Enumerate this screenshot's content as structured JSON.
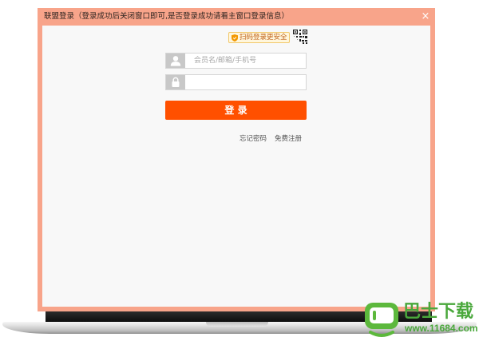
{
  "window": {
    "title": "联盟登录（登录成功后关闭窗口即可,是否登录成功请看主窗口登录信息）",
    "close_label": "×"
  },
  "qr_login": {
    "badge_label": "扫码登录更安全",
    "badge_icon": "shield-icon",
    "toggle_icon": "qr-code-icon"
  },
  "form": {
    "username": {
      "placeholder": "会员名/邮箱/手机号",
      "icon": "user-icon"
    },
    "password": {
      "icon": "lock-icon"
    },
    "login_label": "登 录"
  },
  "links": {
    "forgot_password": "忘记密码",
    "register": "免费注册"
  },
  "watermark": {
    "logo_icon": "monitor-logo-icon",
    "name": "巴士下载",
    "url": "www.11684.com"
  },
  "colors": {
    "frame": "#f8a48a",
    "button": "#ff5000",
    "content_bg": "#f8f8f8",
    "badge_bg": "#fff6dc",
    "watermark": "#4aa83c"
  }
}
